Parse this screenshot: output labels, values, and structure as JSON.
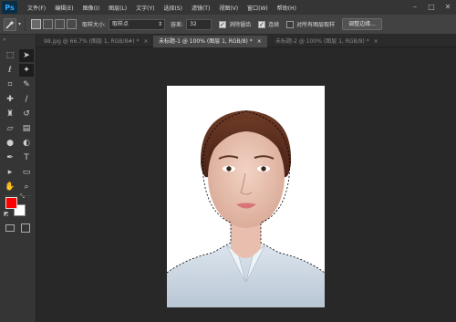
{
  "app": {
    "logo": "Ps"
  },
  "menu": [
    "文件(F)",
    "编辑(E)",
    "图像(I)",
    "图层(L)",
    "文字(Y)",
    "选择(S)",
    "滤镜(T)",
    "视图(V)",
    "窗口(W)",
    "帮助(H)"
  ],
  "window_controls": {
    "minimize": "–",
    "maximize": "□",
    "close": "✕"
  },
  "options": {
    "sample_size_label": "取样大小:",
    "sample_size_value": "取样点",
    "tolerance_label": "容差:",
    "tolerance_value": "32",
    "antialias_label": "消除锯齿",
    "antialias_checked": true,
    "contiguous_label": "连续",
    "contiguous_checked": true,
    "sample_all_label": "对所有图层取样",
    "sample_all_checked": false,
    "refine_edge_button": "调整边缘..."
  },
  "tabs": [
    {
      "label": "98.jpg @ 66.7% (图层 1, RGB/8#) *",
      "active": false
    },
    {
      "label": "未标题-1 @ 100% (图层 1, RGB/8) *",
      "active": true
    },
    {
      "label": "未标题-2 @ 100% (图层 1, RGB/8) *",
      "active": false
    }
  ],
  "tab_close": "×",
  "colors": {
    "foreground": "#ff0000",
    "background": "#ffffff",
    "accent": "#31a8ff"
  },
  "tools": [
    "marquee-icon",
    "move-icon",
    "lasso-icon",
    "magic-wand-icon",
    "crop-icon",
    "eyedropper-icon",
    "healing-icon",
    "brush-icon",
    "stamp-icon",
    "history-brush-icon",
    "eraser-icon",
    "gradient-icon",
    "blur-icon",
    "dodge-icon",
    "pen-icon",
    "type-icon",
    "path-select-icon",
    "shape-icon",
    "hand-icon",
    "zoom-icon"
  ]
}
